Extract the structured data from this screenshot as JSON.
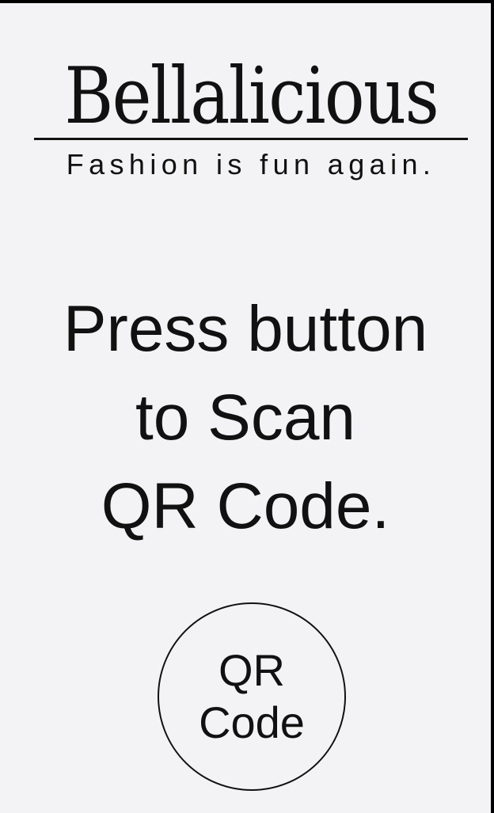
{
  "brand": {
    "name": "Bellalicious",
    "tagline": "Fashion is fun again."
  },
  "instruction": {
    "line1": "Press button",
    "line2": "to Scan",
    "line3": "QR Code."
  },
  "scan_button": {
    "line1": "QR",
    "line2": "Code"
  },
  "colors": {
    "background": "#f3f3f6",
    "text": "#111111",
    "frame": "#000000"
  }
}
